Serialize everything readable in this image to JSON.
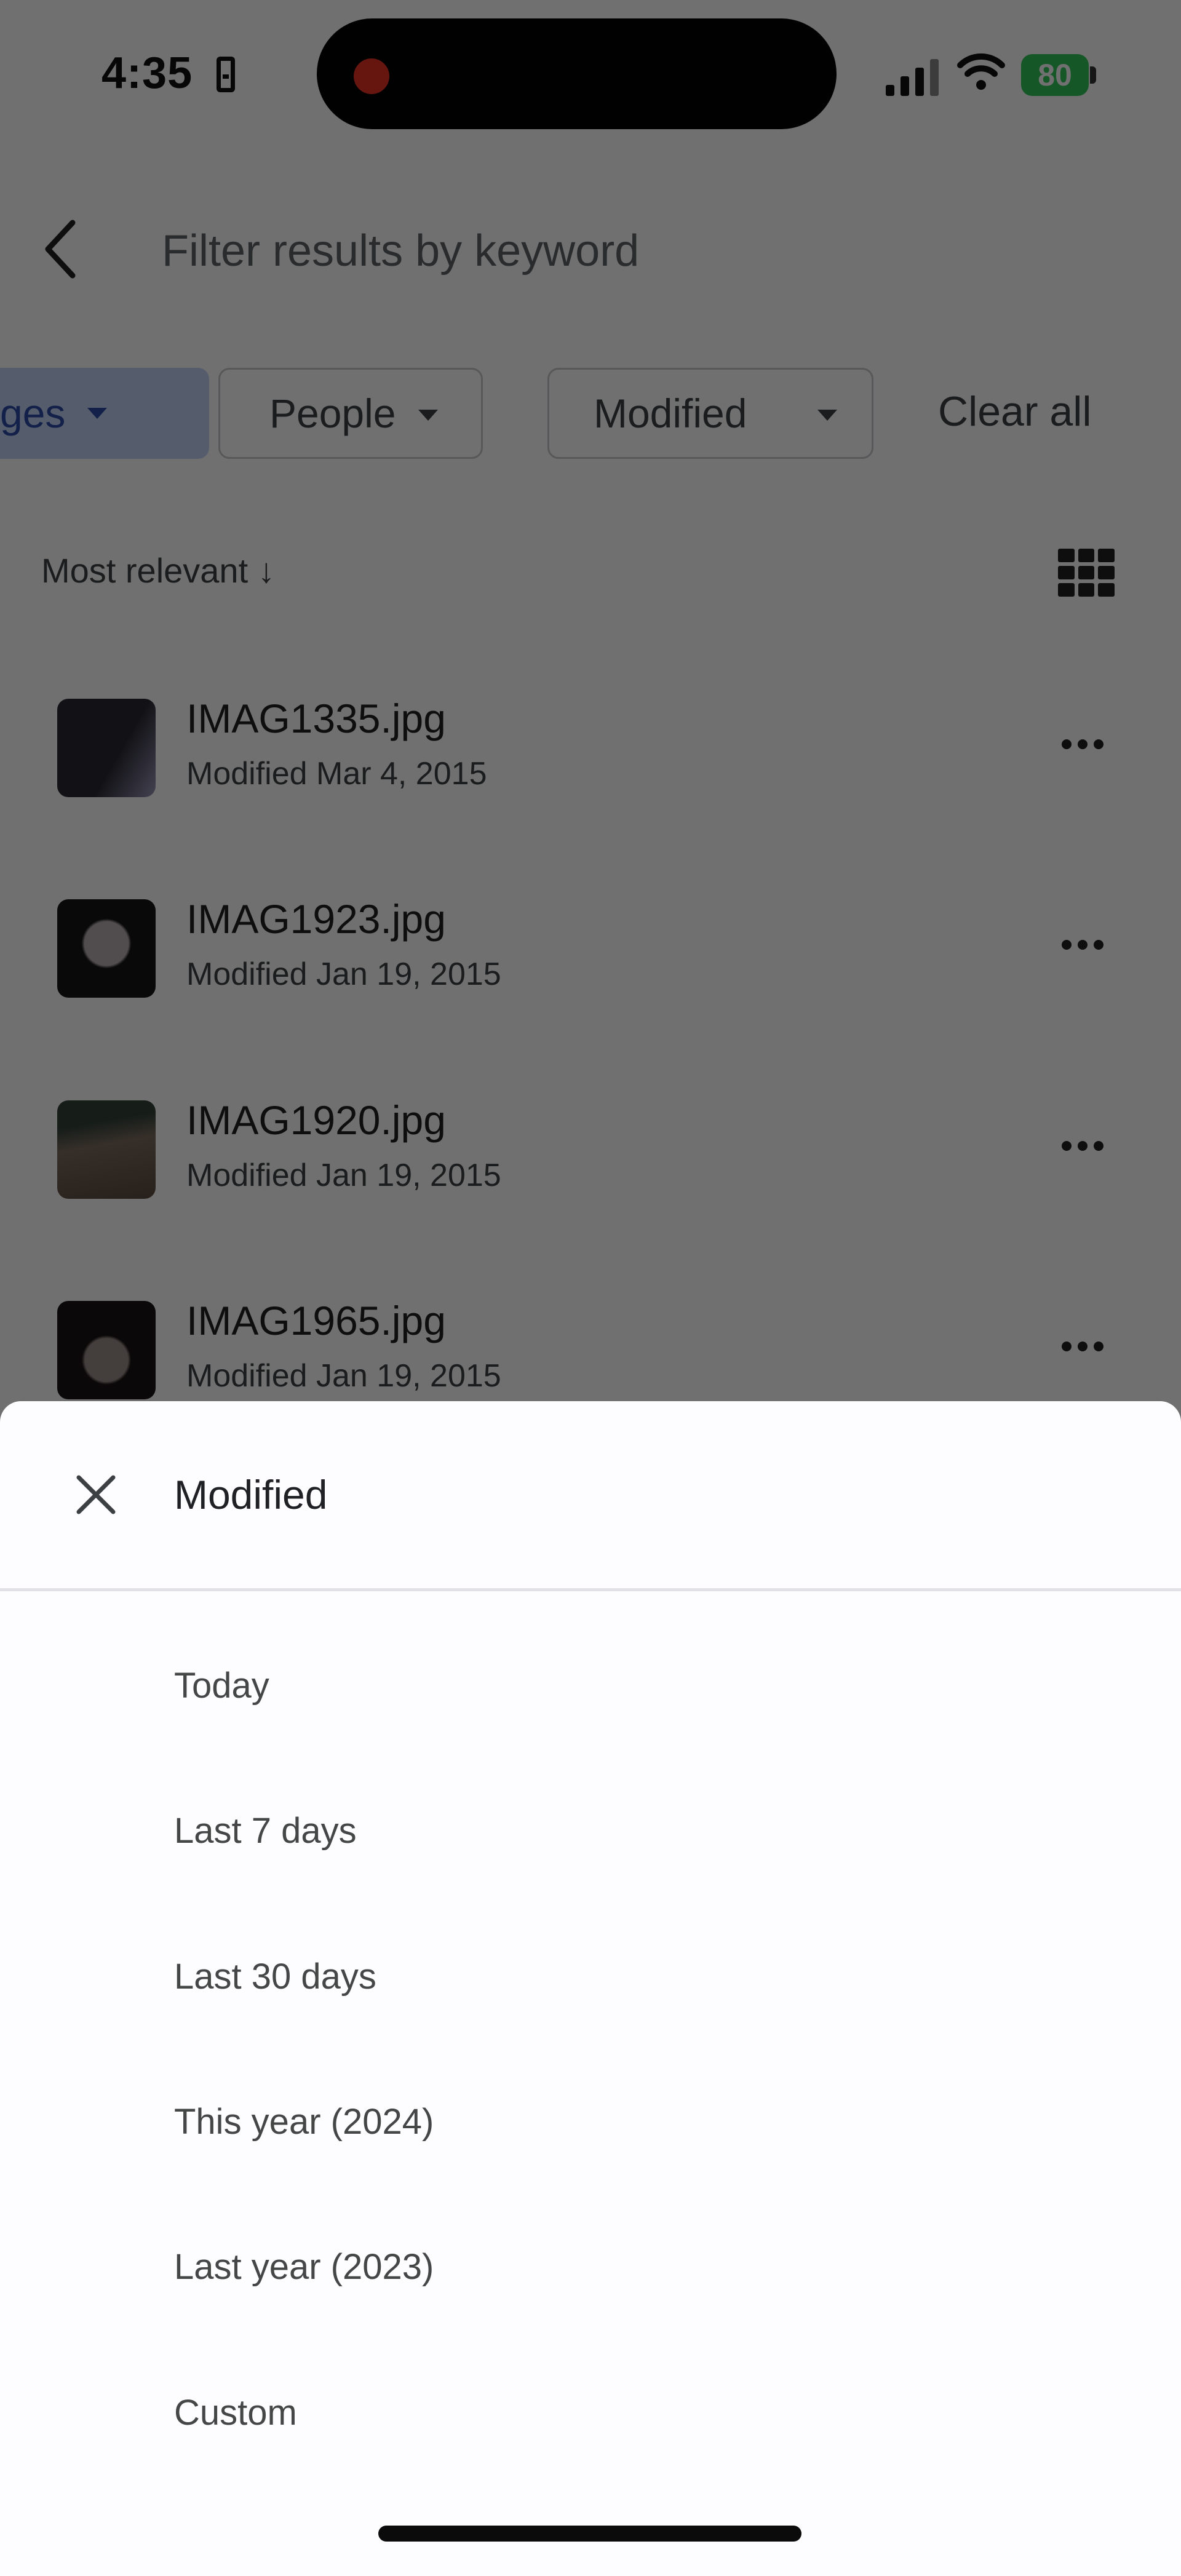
{
  "status_bar": {
    "time": "4:35",
    "battery_level": "80",
    "battery_color": "#34c759",
    "recording_indicator_color": "#ea3323",
    "icons": [
      "sim-card-icon",
      "cellular-signal-icon",
      "wifi-icon",
      "battery-charging-icon"
    ]
  },
  "header": {
    "back_icon": "chevron-left-icon",
    "search_placeholder": "Filter results by keyword",
    "search_value": ""
  },
  "filters": {
    "chips": [
      {
        "label": "Images",
        "visible_label": "ges",
        "active": true,
        "icon": "caret-down-icon"
      },
      {
        "label": "People",
        "active": false,
        "icon": "caret-down-icon"
      },
      {
        "label": "Modified",
        "active": false,
        "icon": "caret-down-icon"
      }
    ],
    "clear_all_label": "Clear all",
    "active_color": "#c2d3f5"
  },
  "sort": {
    "label": "Most relevant",
    "direction_icon": "arrow-down-icon",
    "view_toggle_icon": "grid-view-icon"
  },
  "files": [
    {
      "name": "IMAG1335.jpg",
      "modified": "Modified Mar 4, 2015",
      "thumb_colors": [
        "#2a2a33",
        "#9a96b8"
      ]
    },
    {
      "name": "IMAG1923.jpg",
      "modified": "Modified Jan 19, 2015",
      "thumb_colors": [
        "#151515",
        "#b9aeb2"
      ]
    },
    {
      "name": "IMAG1920.jpg",
      "modified": "Modified Jan 19, 2015",
      "thumb_colors": [
        "#5b4a3e",
        "#33423a"
      ]
    },
    {
      "name": "IMAG1965.jpg",
      "modified": "Modified Jan 19, 2015",
      "thumb_colors": [
        "#1b1416",
        "#9c8f8a"
      ]
    }
  ],
  "sheet": {
    "title": "Modified",
    "close_icon": "close-icon",
    "options": [
      "Today",
      "Last 7 days",
      "Last 30 days",
      "This year (2024)",
      "Last year (2023)",
      "Custom"
    ]
  }
}
